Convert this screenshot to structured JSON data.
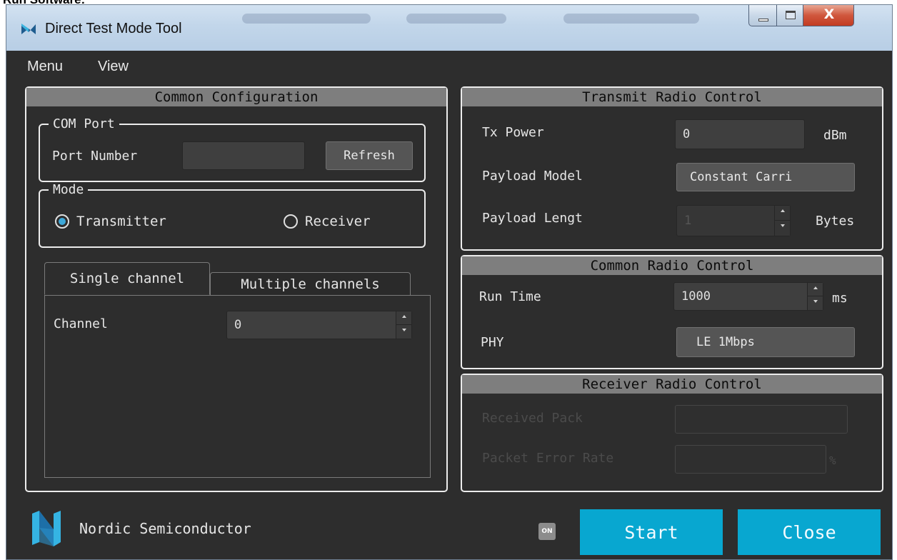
{
  "page_header": "Run Software:",
  "window": {
    "title": "Direct Test Mode Tool"
  },
  "menu": [
    {
      "label": "Menu"
    },
    {
      "label": "View"
    }
  ],
  "common_config": {
    "title": "Common Configuration",
    "com_port": {
      "legend": "COM Port",
      "port_number_label": "Port Number",
      "port_number_value": "",
      "refresh_label": "Refresh"
    },
    "mode": {
      "legend": "Mode",
      "options": [
        {
          "label": "Transmitter",
          "checked": true
        },
        {
          "label": "Receiver",
          "checked": false
        }
      ]
    },
    "tabs": [
      {
        "label": "Single channel",
        "active": true
      },
      {
        "label": "Multiple channels",
        "active": false
      }
    ],
    "channel": {
      "label": "Channel",
      "value": "0"
    }
  },
  "transmit": {
    "title": "Transmit Radio Control",
    "tx_power": {
      "label": "Tx Power",
      "value": "0",
      "unit": "dBm"
    },
    "payload_model": {
      "label": "Payload Model",
      "value": "Constant Carri"
    },
    "payload_length": {
      "label": "Payload Lengt",
      "value": "1",
      "unit": "Bytes"
    }
  },
  "common_radio": {
    "title": "Common Radio Control",
    "run_time": {
      "label": "Run Time",
      "value": "1000",
      "unit": "ms"
    },
    "phy": {
      "label": "PHY",
      "value": "LE 1Mbps"
    }
  },
  "receiver": {
    "title": "Receiver Radio Control",
    "received_pack": {
      "label": "Received Pack",
      "value": ""
    },
    "per": {
      "label": "Packet Error Rate",
      "value": "",
      "unit": "%"
    }
  },
  "footer": {
    "brand": "Nordic Semiconductor",
    "status_badge": "ON",
    "start_label": "Start",
    "close_label": "Close"
  },
  "colors": {
    "accent": "#08a7d0",
    "background": "#2d2d2d",
    "panel_title": "#7e7e7e",
    "radio_checked": "#3ea8d8"
  },
  "icons": {
    "app": "nordic-logo-icon",
    "footer": "nordic-logo-icon",
    "badge": "on-badge-icon"
  }
}
